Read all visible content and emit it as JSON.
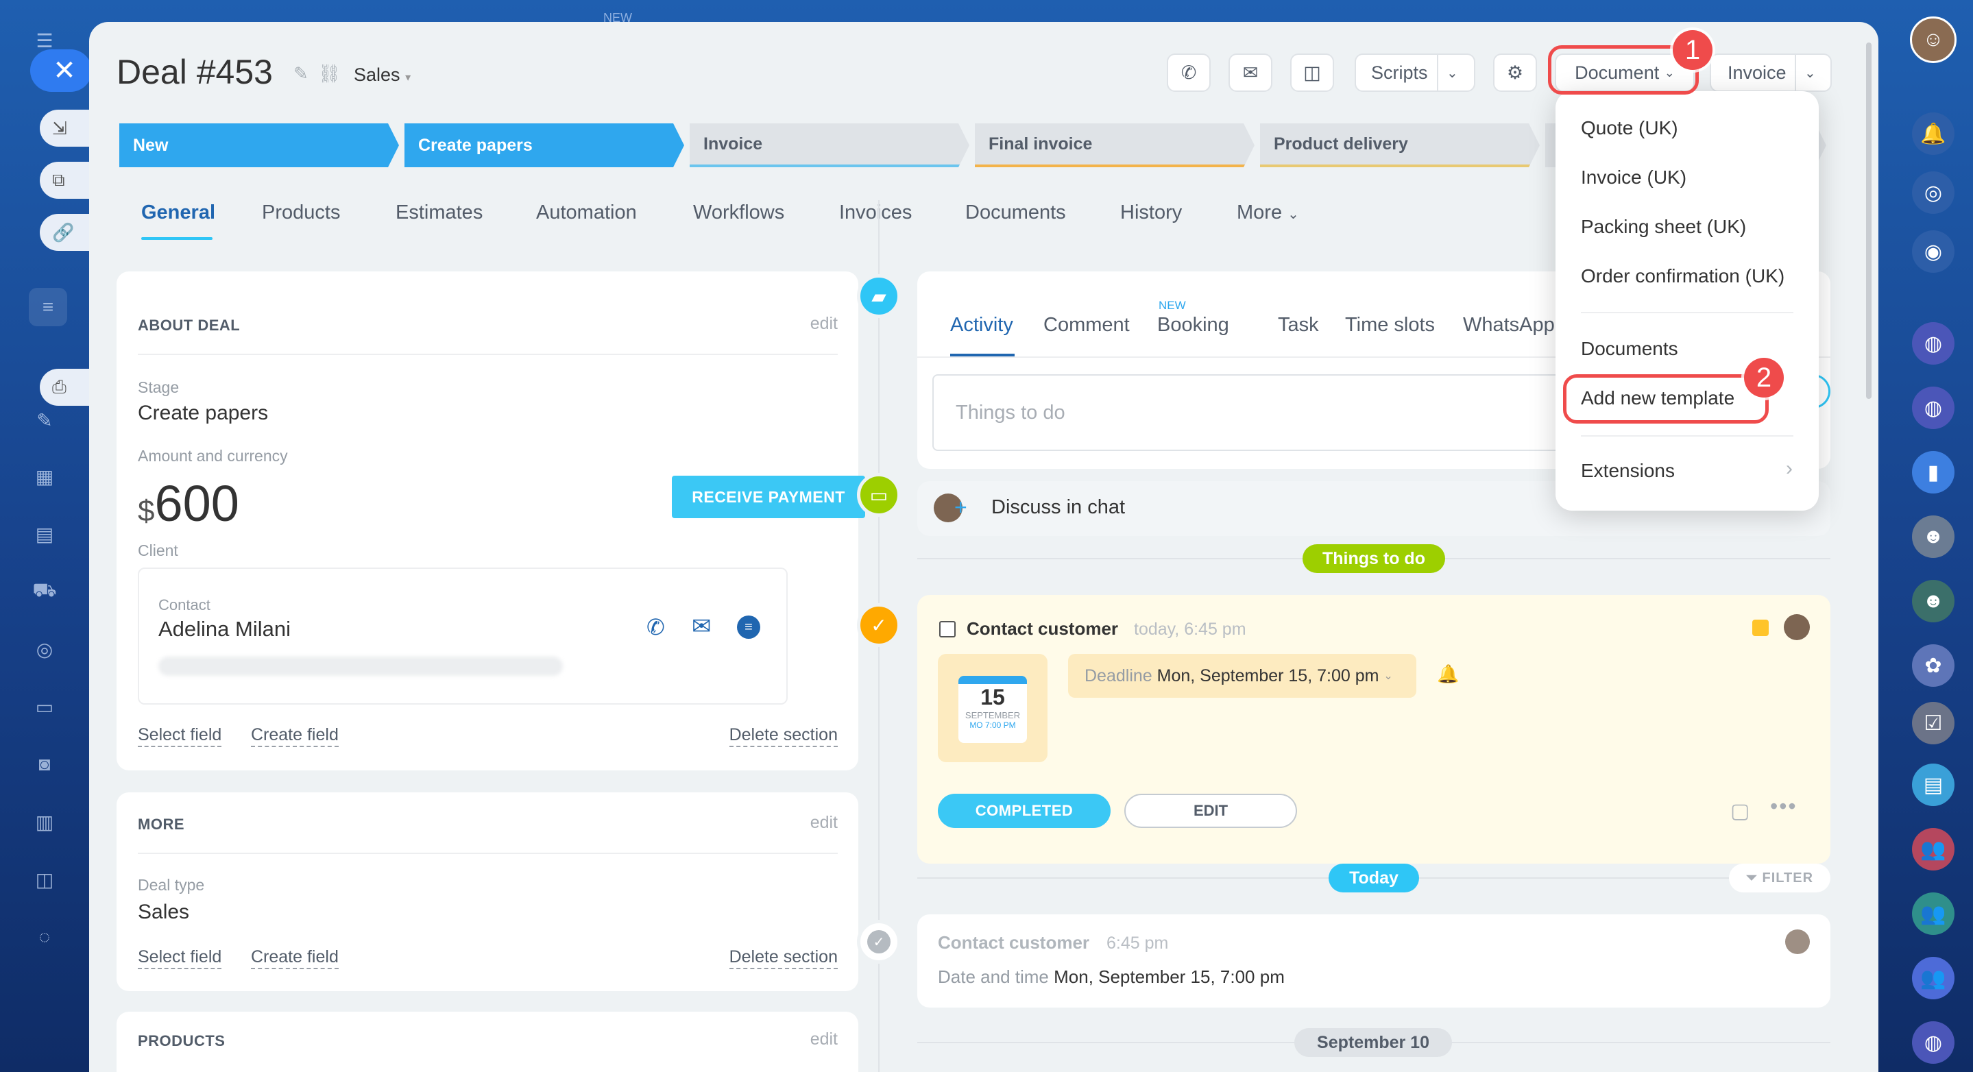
{
  "header": {
    "title": "Deal #453",
    "pipeline": "Sales",
    "scripts_label": "Scripts",
    "document_label": "Document",
    "invoice_label": "Invoice"
  },
  "stages": [
    "New",
    "Create papers",
    "Invoice",
    "Final invoice",
    "Product delivery"
  ],
  "tabs": [
    "General",
    "Products",
    "Estimates",
    "Automation",
    "Workflows",
    "Invoices",
    "Documents",
    "History",
    "More"
  ],
  "about": {
    "heading": "ABOUT DEAL",
    "edit": "edit",
    "stage_label": "Stage",
    "stage_value": "Create papers",
    "amount_label": "Amount and currency",
    "currency": "$",
    "amount": "600",
    "receive_payment": "RECEIVE PAYMENT",
    "client_label": "Client",
    "contact_label": "Contact",
    "contact_name": "Adelina Milani",
    "select_field": "Select field",
    "create_field": "Create field",
    "delete_section": "Delete section"
  },
  "more": {
    "heading": "MORE",
    "edit": "edit",
    "deal_type_label": "Deal type",
    "deal_type_value": "Sales",
    "select_field": "Select field",
    "create_field": "Create field",
    "delete_section": "Delete section"
  },
  "products": {
    "heading": "PRODUCTS",
    "edit": "edit"
  },
  "activity": {
    "tabs": [
      "Activity",
      "Comment",
      "Booking",
      "Task",
      "Time slots",
      "WhatsApp"
    ],
    "new_tag": "NEW",
    "placeholder": "Things to do",
    "discuss": "Discuss in chat",
    "things_pill": "Things to do",
    "task_title": "Contact customer",
    "task_time": "today, 6:45 pm",
    "cal_day": "15",
    "cal_month": "SEPTEMBER",
    "cal_time": "MO 7:00 PM",
    "deadline_label": "Deadline",
    "deadline_value": "Mon, September 15, 7:00 pm",
    "completed": "COMPLETED",
    "edit": "EDIT",
    "today_pill": "Today",
    "filter": "FILTER",
    "done_title": "Contact customer",
    "done_time": "6:45 pm",
    "datetime_label": "Date and time",
    "datetime_value": "Mon, September 15, 7:00 pm",
    "sep10": "September 10"
  },
  "dropdown": {
    "items": [
      "Quote (UK)",
      "Invoice (UK)",
      "Packing sheet (UK)",
      "Order confirmation (UK)",
      "Documents",
      "Add new template",
      "Extensions"
    ]
  },
  "annotations": {
    "step1": "1",
    "step2": "2"
  },
  "topbar_new": "NEW"
}
